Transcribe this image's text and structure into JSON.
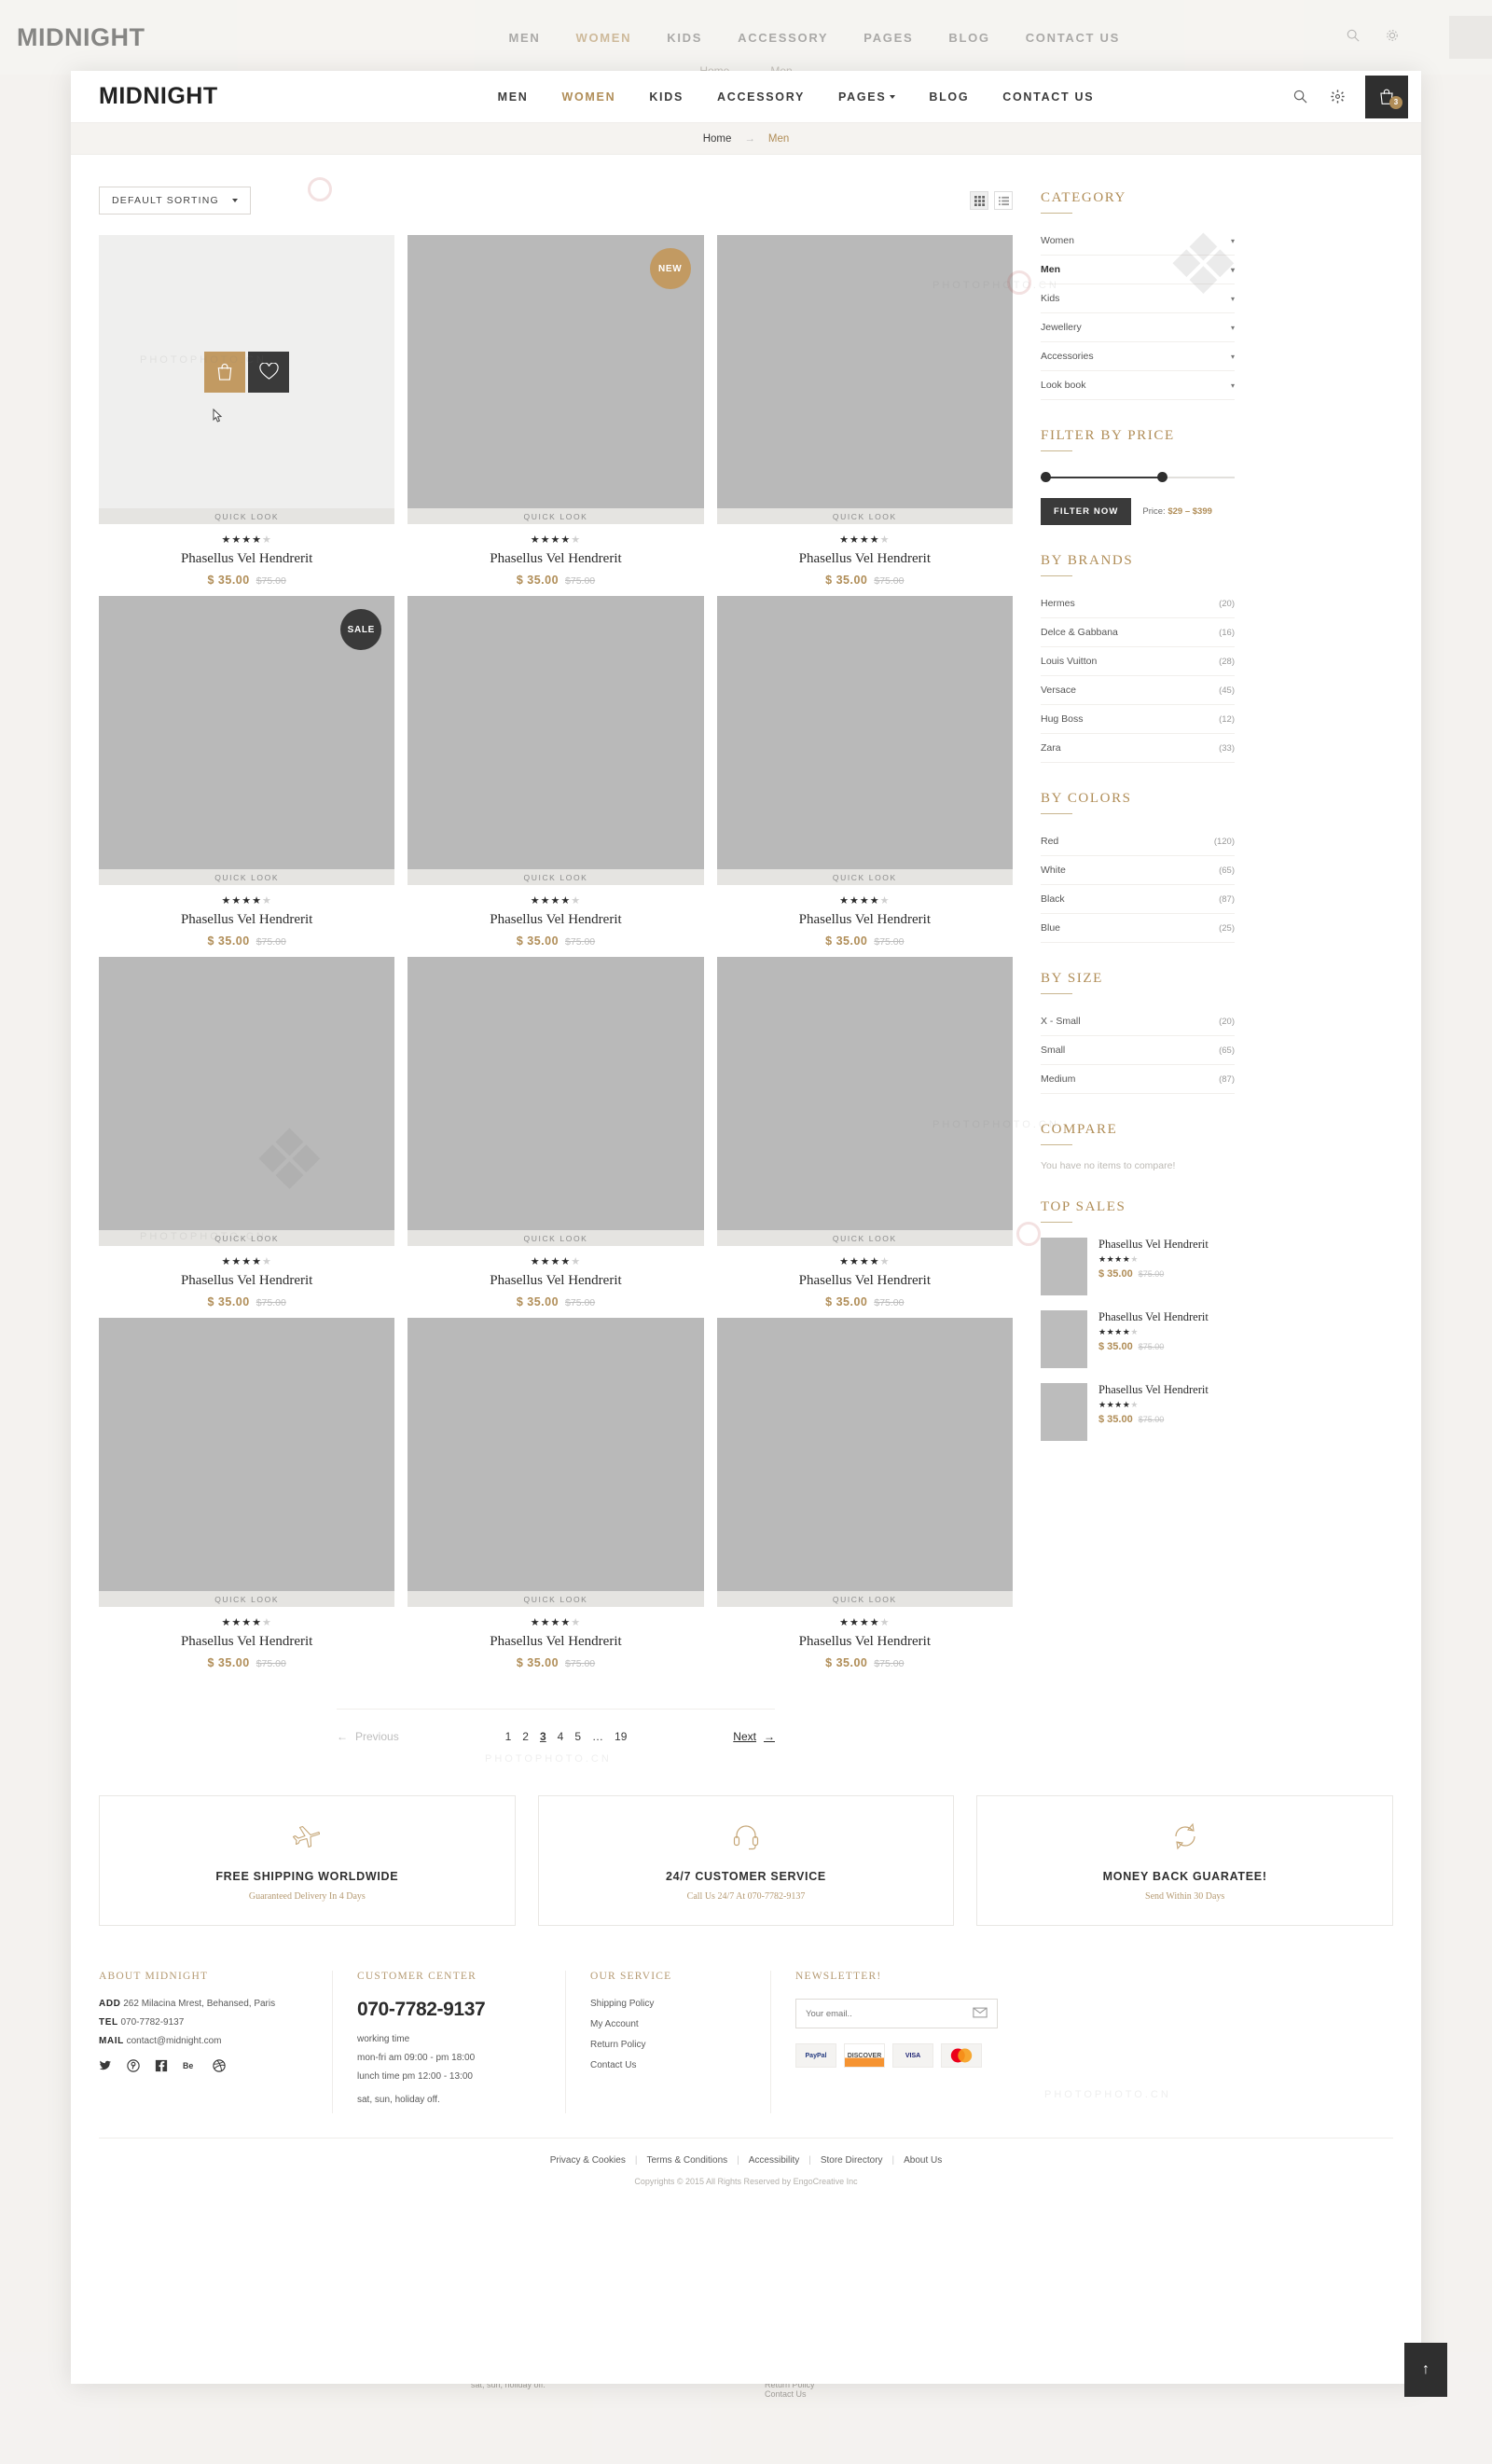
{
  "brand": {
    "name": "MIDNIGHT"
  },
  "header": {
    "nav": [
      {
        "label": "MEN",
        "active": false,
        "caret": false
      },
      {
        "label": "WOMEN",
        "active": true,
        "caret": false
      },
      {
        "label": "KIDS",
        "active": false,
        "caret": false
      },
      {
        "label": "ACCESSORY",
        "active": false,
        "caret": false
      },
      {
        "label": "PAGES",
        "active": false,
        "caret": true
      },
      {
        "label": "BLOG",
        "active": false,
        "caret": false
      },
      {
        "label": "CONTACT US",
        "active": false,
        "caret": false
      }
    ],
    "icons": [
      "search-icon",
      "gear-icon",
      "cart-icon"
    ],
    "cart_count": "3"
  },
  "breadcrumb": {
    "home": "Home",
    "separator": "→",
    "current": "Men"
  },
  "toolbar": {
    "sorting_label": "DEFAULT SORTING",
    "view_grid": "grid-view-icon",
    "view_list": "list-view-icon"
  },
  "products": [
    {
      "title": "Phasellus Vel Hendrerit",
      "price": "$ 35.00",
      "old_price": "$75.00",
      "rating": 4,
      "badge": "",
      "quick_look": "QUICK LOOK",
      "hovered": true
    },
    {
      "title": "Phasellus Vel Hendrerit",
      "price": "$ 35.00",
      "old_price": "$75.00",
      "rating": 4,
      "badge": "NEW",
      "quick_look": "QUICK LOOK",
      "hovered": false
    },
    {
      "title": "Phasellus Vel Hendrerit",
      "price": "$ 35.00",
      "old_price": "$75.00",
      "rating": 4,
      "badge": "",
      "quick_look": "QUICK LOOK",
      "hovered": false
    },
    {
      "title": "Phasellus Vel Hendrerit",
      "price": "$ 35.00",
      "old_price": "$75.00",
      "rating": 4,
      "badge": "SALE",
      "quick_look": "QUICK LOOK",
      "hovered": false
    },
    {
      "title": "Phasellus Vel Hendrerit",
      "price": "$ 35.00",
      "old_price": "$75.00",
      "rating": 4,
      "badge": "",
      "quick_look": "QUICK LOOK",
      "hovered": false
    },
    {
      "title": "Phasellus Vel Hendrerit",
      "price": "$ 35.00",
      "old_price": "$75.00",
      "rating": 4,
      "badge": "",
      "quick_look": "QUICK LOOK",
      "hovered": false
    },
    {
      "title": "Phasellus Vel Hendrerit",
      "price": "$ 35.00",
      "old_price": "$75.00",
      "rating": 4,
      "badge": "",
      "quick_look": "QUICK LOOK",
      "hovered": false
    },
    {
      "title": "Phasellus Vel Hendrerit",
      "price": "$ 35.00",
      "old_price": "$75.00",
      "rating": 4,
      "badge": "",
      "quick_look": "QUICK LOOK",
      "hovered": false
    },
    {
      "title": "Phasellus Vel Hendrerit",
      "price": "$ 35.00",
      "old_price": "$75.00",
      "rating": 4,
      "badge": "",
      "quick_look": "QUICK LOOK",
      "hovered": false
    },
    {
      "title": "Phasellus Vel Hendrerit",
      "price": "$ 35.00",
      "old_price": "$75.00",
      "rating": 4,
      "badge": "",
      "quick_look": "QUICK LOOK",
      "hovered": false
    },
    {
      "title": "Phasellus Vel Hendrerit",
      "price": "$ 35.00",
      "old_price": "$75.00",
      "rating": 4,
      "badge": "",
      "quick_look": "QUICK LOOK",
      "hovered": false
    },
    {
      "title": "Phasellus Vel Hendrerit",
      "price": "$ 35.00",
      "old_price": "$75.00",
      "rating": 4,
      "badge": "",
      "quick_look": "QUICK LOOK",
      "hovered": false
    }
  ],
  "sidebar": {
    "category": {
      "title": "CATEGORY",
      "items": [
        {
          "label": "Women",
          "active": false
        },
        {
          "label": "Men",
          "active": true
        },
        {
          "label": "Kids",
          "active": false
        },
        {
          "label": "Jewellery",
          "active": false
        },
        {
          "label": "Accessories",
          "active": false
        },
        {
          "label": "Look book",
          "active": false
        }
      ]
    },
    "price_filter": {
      "title": "FILTER BY PRICE",
      "button": "FILTER NOW",
      "label": "Price:",
      "range": "$29 – $399"
    },
    "brands": {
      "title": "BY BRANDS",
      "items": [
        {
          "label": "Hermes",
          "count": "(20)"
        },
        {
          "label": "Delce & Gabbana",
          "count": "(16)"
        },
        {
          "label": "Louis Vuitton",
          "count": "(28)"
        },
        {
          "label": "Versace",
          "count": "(45)"
        },
        {
          "label": "Hug Boss",
          "count": "(12)"
        },
        {
          "label": "Zara",
          "count": "(33)"
        }
      ]
    },
    "colors": {
      "title": "BY COLORS",
      "items": [
        {
          "label": "Red",
          "count": "(120)"
        },
        {
          "label": "White",
          "count": "(65)"
        },
        {
          "label": "Black",
          "count": "(87)"
        },
        {
          "label": "Blue",
          "count": "(25)"
        }
      ]
    },
    "sizes": {
      "title": "BY SIZE",
      "items": [
        {
          "label": "X - Small",
          "count": "(20)"
        },
        {
          "label": "Small",
          "count": "(65)"
        },
        {
          "label": "Medium",
          "count": "(87)"
        }
      ]
    },
    "compare": {
      "title": "COMPARE",
      "empty": "You have no items to compare!"
    },
    "top_sales": {
      "title": "TOP SALES",
      "items": [
        {
          "title": "Phasellus Vel Hendrerit",
          "rating": 4,
          "price": "$ 35.00",
          "old_price": "$75.00"
        },
        {
          "title": "Phasellus Vel Hendrerit",
          "rating": 4,
          "price": "$ 35.00",
          "old_price": "$75.00"
        },
        {
          "title": "Phasellus Vel Hendrerit",
          "rating": 4,
          "price": "$ 35.00",
          "old_price": "$75.00"
        }
      ]
    }
  },
  "pagination": {
    "previous": "Previous",
    "next": "Next",
    "pages": [
      "1",
      "2",
      "3",
      "4",
      "5",
      "…",
      "19"
    ],
    "current": "3"
  },
  "services": [
    {
      "icon": "airplane-icon",
      "heading": "FREE SHIPPING WORLDWIDE",
      "sub": "Guaranteed Delivery In 4 Days"
    },
    {
      "icon": "headset-icon",
      "heading": "24/7 CUSTOMER SERVICE",
      "sub": "Call Us 24/7 At 070-7782-9137"
    },
    {
      "icon": "refresh-icon",
      "heading": "MONEY BACK GUARATEE!",
      "sub": "Send Within 30 Days"
    }
  ],
  "footer": {
    "about": {
      "title": "ABOUT MIDNIGHT",
      "add_label": "ADD",
      "add_value": "262 Milacina Mrest, Behansed, Paris",
      "tel_label": "TEL",
      "tel_value": "070-7782-9137",
      "mail_label": "MAIL",
      "mail_value": "contact@midnight.com",
      "socials": [
        "twitter-icon",
        "pinterest-icon",
        "facebook-icon",
        "behance-icon",
        "dribbble-icon"
      ]
    },
    "customer_center": {
      "title": "CUSTOMER CENTER",
      "phone": "070-7782-9137",
      "lines": [
        "working time",
        "mon-fri am 09:00 - pm 18:00",
        "lunch time pm 12:00 - 13:00",
        "sat, sun, holiday off."
      ]
    },
    "service": {
      "title": "OUR SERVICE",
      "links": [
        "Shipping Policy",
        "My Account",
        "Return Policy",
        "Contact Us"
      ]
    },
    "newsletter": {
      "title": "NEWSLETTER!",
      "placeholder": "Your email..",
      "cards": [
        "PayPal",
        "DISCOVER",
        "VISA",
        "MasterCard"
      ]
    },
    "bottom_links": [
      "Privacy & Cookies",
      "Terms & Conditions",
      "Accessibility",
      "Store Directory",
      "About Us"
    ],
    "copyright": "Copyrights © 2015 All Rights Reserved by EngoCreative Inc"
  },
  "to_top": "↑",
  "colors": {
    "accent": "#b08d57",
    "dark": "#2f2f2f",
    "muted": "#bdbdbd"
  }
}
